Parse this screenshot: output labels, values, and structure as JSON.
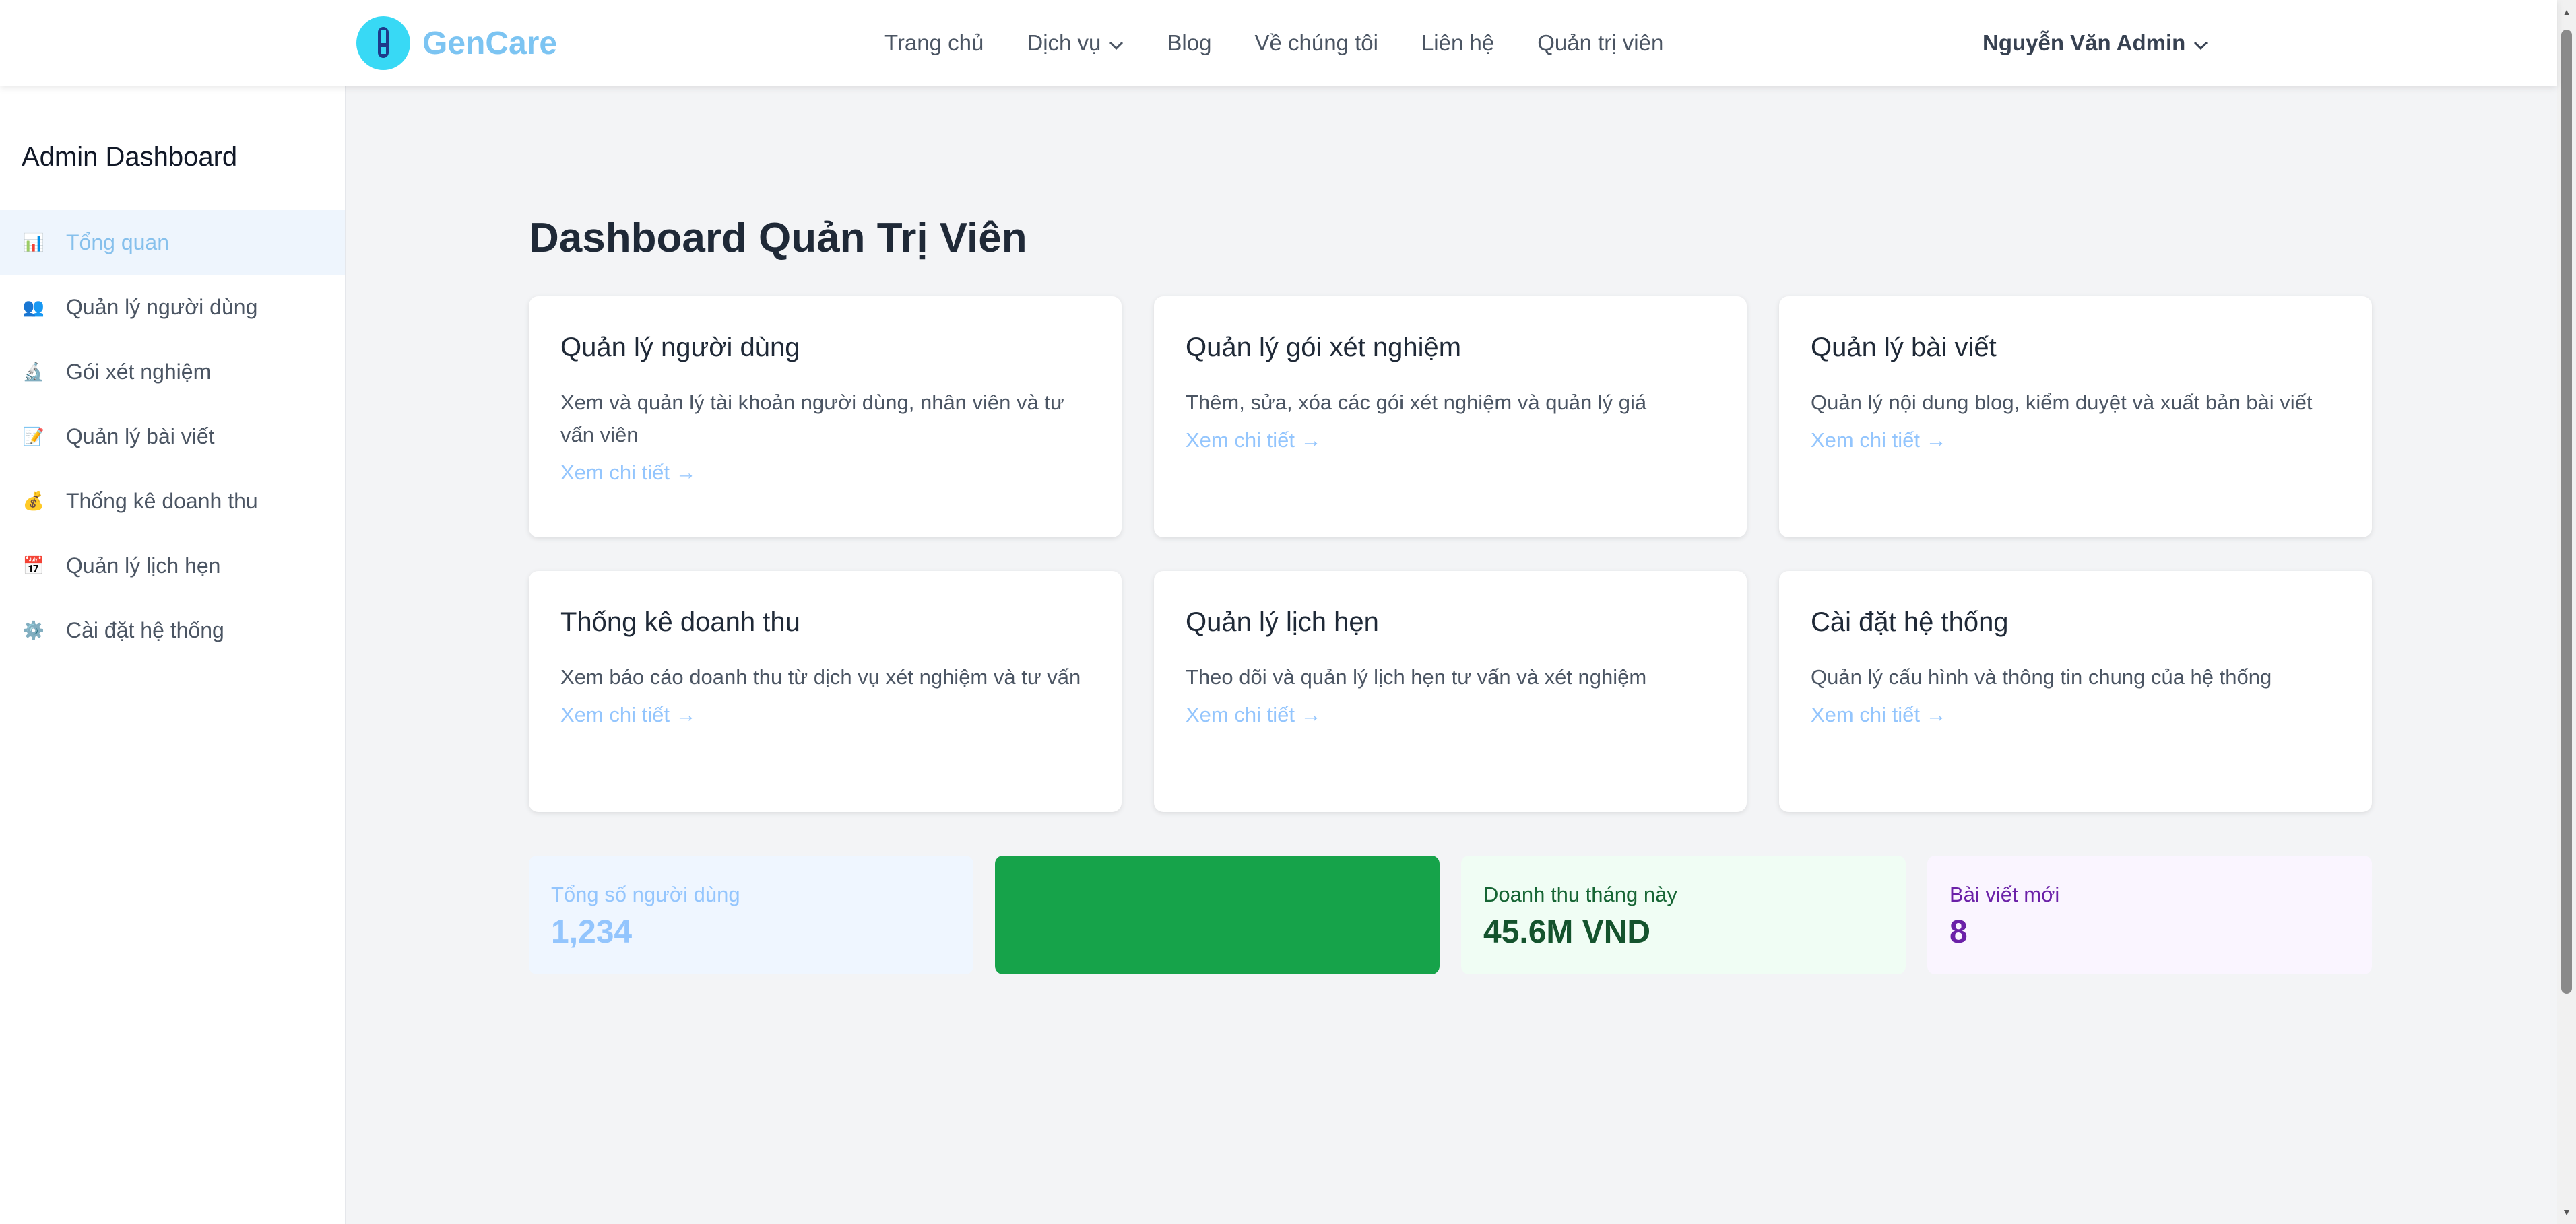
{
  "header": {
    "brand": "GenCare",
    "nav": [
      {
        "label": "Trang chủ",
        "dropdown": false
      },
      {
        "label": "Dịch vụ",
        "dropdown": true
      },
      {
        "label": "Blog",
        "dropdown": false
      },
      {
        "label": "Về chúng tôi",
        "dropdown": false
      },
      {
        "label": "Liên hệ",
        "dropdown": false
      },
      {
        "label": "Quản trị viên",
        "dropdown": false
      }
    ],
    "user_name": "Nguyễn Văn Admin"
  },
  "sidebar": {
    "title": "Admin Dashboard",
    "items": [
      {
        "label": "Tổng quan",
        "icon": "bar-chart-icon",
        "glyph": "📊",
        "active": true
      },
      {
        "label": "Quản lý người dùng",
        "icon": "users-icon",
        "glyph": "👥",
        "active": false
      },
      {
        "label": "Gói xét nghiệm",
        "icon": "microscope-icon",
        "glyph": "🔬",
        "active": false
      },
      {
        "label": "Quản lý bài viết",
        "icon": "memo-icon",
        "glyph": "📝",
        "active": false
      },
      {
        "label": "Thống kê doanh thu",
        "icon": "money-bag-icon",
        "glyph": "💰",
        "active": false
      },
      {
        "label": "Quản lý lịch hẹn",
        "icon": "calendar-icon",
        "glyph": "📅",
        "active": false
      },
      {
        "label": "Cài đặt hệ thống",
        "icon": "gear-icon",
        "glyph": "⚙️",
        "active": false
      }
    ]
  },
  "main": {
    "title": "Dashboard Quản Trị Viên",
    "cards": [
      {
        "title": "Quản lý người dùng",
        "description": "Xem và quản lý tài khoản người dùng, nhân viên và tư vấn viên",
        "link": "Xem chi tiết →"
      },
      {
        "title": "Quản lý gói xét nghiệm",
        "description": "Thêm, sửa, xóa các gói xét nghiệm và quản lý giá",
        "link": "Xem chi tiết →"
      },
      {
        "title": "Quản lý bài viết",
        "description": "Quản lý nội dung blog, kiểm duyệt và xuất bản bài viết",
        "link": "Xem chi tiết →"
      },
      {
        "title": "Thống kê doanh thu",
        "description": "Xem báo cáo doanh thu từ dịch vụ xét nghiệm và tư vấn",
        "link": "Xem chi tiết →"
      },
      {
        "title": "Quản lý lịch hẹn",
        "description": "Theo dõi và quản lý lịch hẹn tư vấn và xét nghiệm",
        "link": "Xem chi tiết →"
      },
      {
        "title": "Cài đặt hệ thống",
        "description": "Quản lý cấu hình và thông tin chung của hệ thống",
        "link": "Xem chi tiết →"
      }
    ],
    "stats": [
      {
        "label": "Tổng số người dùng",
        "value": "1,234",
        "bg": "#eff6ff",
        "label_color": "#93c5fd",
        "value_color": "#93c5fd"
      },
      {
        "label": "",
        "value": "",
        "bg": "#16a34a",
        "label_color": "#16a34a",
        "value_color": "#16a34a"
      },
      {
        "label": "Doanh thu tháng này",
        "value": "45.6M VND",
        "bg": "#f0fdf4",
        "label_color": "#166534",
        "value_color": "#14532d"
      },
      {
        "label": "Bài viết mới",
        "value": "8",
        "bg": "#faf5ff",
        "label_color": "#6b21a8",
        "value_color": "#6b21a8"
      }
    ]
  },
  "colors": {
    "accent": "#86c0ec",
    "logo_circle": "#38d9f5",
    "active_bg": "#eef5fd"
  }
}
